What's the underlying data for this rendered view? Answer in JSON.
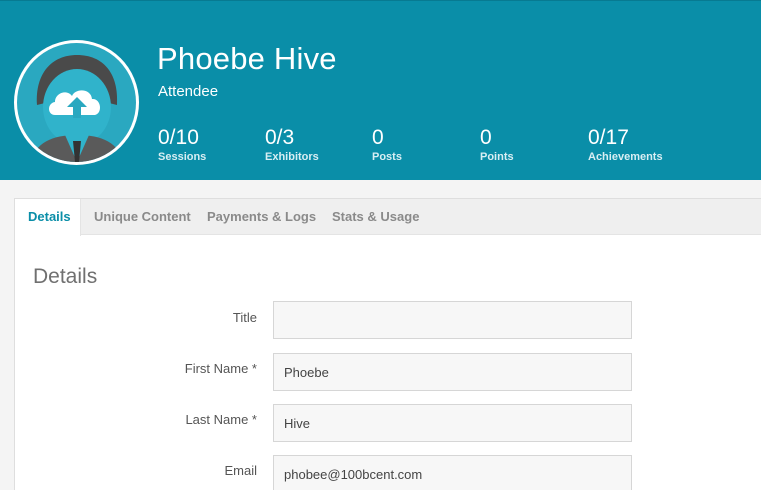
{
  "profile": {
    "name": "Phoebe Hive",
    "role": "Attendee"
  },
  "stats": [
    {
      "value": "0/10",
      "label": "Sessions"
    },
    {
      "value": "0/3",
      "label": "Exhibitors"
    },
    {
      "value": "0",
      "label": "Posts"
    },
    {
      "value": "0",
      "label": "Points"
    },
    {
      "value": "0/17",
      "label": "Achievements"
    }
  ],
  "tabs": [
    {
      "label": "Details",
      "active": true
    },
    {
      "label": "Unique Content"
    },
    {
      "label": "Payments & Logs"
    },
    {
      "label": "Stats & Usage"
    }
  ],
  "details": {
    "title": "Details",
    "fields": [
      {
        "label": "Title",
        "value": ""
      },
      {
        "label": "First Name *",
        "value": "Phoebe"
      },
      {
        "label": "Last Name *",
        "value": "Hive"
      },
      {
        "label": "Email",
        "value": "phobee@100bcent.com"
      }
    ]
  },
  "icons": {
    "avatar": "avatar-upload-icon"
  },
  "colors": {
    "header": "#0a8ea8",
    "accent": "#0a8ea8"
  }
}
